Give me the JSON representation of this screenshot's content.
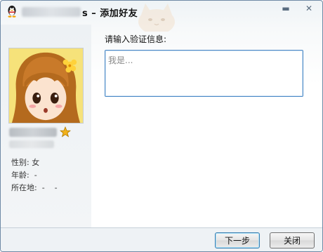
{
  "window": {
    "title_suffix": "s – 添加好友",
    "minimize_glyph": "▬",
    "close_glyph": "✕"
  },
  "profile": {
    "gender_label": "性别: 女",
    "age_label": "年龄:  -",
    "location_label": "所在地:  -    -"
  },
  "form": {
    "prompt": "请输入验证信息:",
    "placeholder": "我是..."
  },
  "buttons": {
    "next": "下一步",
    "close": "关闭"
  },
  "colors": {
    "accent": "#4d8ac6",
    "star": "#f2b21b"
  }
}
